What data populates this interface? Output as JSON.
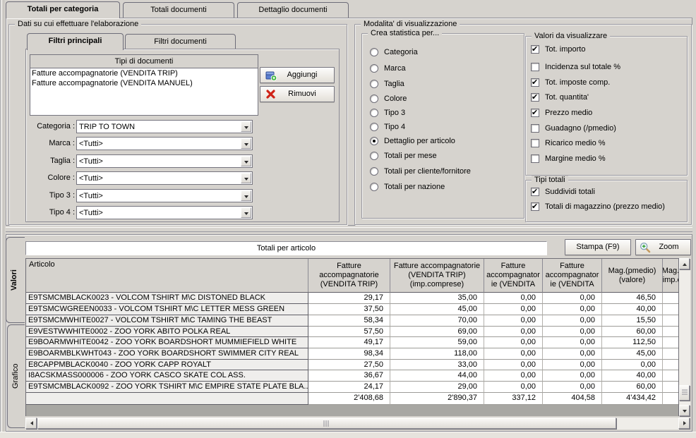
{
  "window": {
    "tabs": [
      {
        "label": "Totali per categoria",
        "selected": true
      },
      {
        "label": "Totali documenti",
        "selected": false
      },
      {
        "label": "Dettaglio documenti",
        "selected": false
      }
    ]
  },
  "filters_panel": {
    "group_title": "Dati su cui effettuare l'elaborazione",
    "tabs": [
      {
        "label": "Filtri principali",
        "selected": true
      },
      {
        "label": "Filtri documenti",
        "selected": false
      }
    ],
    "doc_types": {
      "header": "Tipi di documenti",
      "items": [
        "Fatture accompagnatorie (VENDITA TRIP)",
        "Fatture accompagnatorie (VENDITA MANUEL)"
      ]
    },
    "buttons": {
      "add": "Aggiungi",
      "remove": "Rimuovi"
    },
    "selectors": [
      {
        "label": "Categoria :",
        "value": "TRIP TO TOWN"
      },
      {
        "label": "Marca :",
        "value": "<Tutti>"
      },
      {
        "label": "Taglia :",
        "value": "<Tutti>"
      },
      {
        "label": "Colore :",
        "value": "<Tutti>"
      },
      {
        "label": "Tipo 3 :",
        "value": "<Tutti>"
      },
      {
        "label": "Tipo 4 :",
        "value": "<Tutti>"
      }
    ]
  },
  "display_panel": {
    "group_title": "Modalita' di visualizzazione",
    "statistic": {
      "group_title": "Crea statistica per...",
      "options": [
        {
          "label": "Categoria",
          "selected": false
        },
        {
          "label": "Marca",
          "selected": false
        },
        {
          "label": "Taglia",
          "selected": false
        },
        {
          "label": "Colore",
          "selected": false
        },
        {
          "label": "Tipo 3",
          "selected": false
        },
        {
          "label": "Tipo 4",
          "selected": false
        },
        {
          "label": "Dettaglio per articolo",
          "selected": true
        },
        {
          "label": "Totali per mese",
          "selected": false
        },
        {
          "label": "Totali per cliente/fornitore",
          "selected": false
        },
        {
          "label": "Totali per nazione",
          "selected": false
        }
      ]
    },
    "values": {
      "group_title": "Valori da visualizzare",
      "options": [
        {
          "label": "Tot. importo",
          "checked": true
        },
        {
          "label": "Incidenza sul totale %",
          "checked": false
        },
        {
          "label": "Tot. imposte comp.",
          "checked": true
        },
        {
          "label": "Tot. quantita'",
          "checked": true
        },
        {
          "label": "Prezzo medio",
          "checked": true
        },
        {
          "label": "Guadagno (/pmedio)",
          "checked": false
        },
        {
          "label": "Ricarico medio %",
          "checked": false
        },
        {
          "label": "Margine medio %",
          "checked": false
        }
      ]
    },
    "totals": {
      "group_title": "Tipi totali",
      "options": [
        {
          "label": "Suddividi totali",
          "checked": true
        },
        {
          "label": "Totali di magazzino (prezzo medio)",
          "checked": true
        }
      ]
    }
  },
  "results_panel": {
    "side_tabs": [
      {
        "label": "Valori",
        "selected": true
      },
      {
        "label": "Grafico",
        "selected": false
      }
    ],
    "title": "Totali per articolo",
    "buttons": {
      "print": "Stampa (F9)",
      "zoom": "Zoom"
    },
    "table": {
      "columns": [
        "Articolo",
        "Fatture\naccompagnatorie\n(VENDITA TRIP)",
        "Fatture accompagnatorie\n(VENDITA TRIP)\n(imp.comprese)",
        "Fatture\naccompagnator\nie (VENDITA",
        "Fatture\naccompagnator\nie (VENDITA",
        "Mag.(pmedio)\n(valore)",
        "Mag.\n(imp.c"
      ],
      "rows": [
        {
          "article": "E9TSMCMBLACK0023 - VOLCOM TSHIRT M\\C DISTONED BLACK",
          "v": [
            "29,17",
            "35,00",
            "0,00",
            "0,00",
            "46,50"
          ]
        },
        {
          "article": "E9TSMCWGREEN0033 - VOLCOM TSHIRT M\\C LETTER MESS GREEN",
          "v": [
            "37,50",
            "45,00",
            "0,00",
            "0,00",
            "40,00"
          ]
        },
        {
          "article": "E9TSMCMWHITE0027 - VOLCOM TSHIRT M\\C TAMING THE BEAST",
          "v": [
            "58,34",
            "70,00",
            "0,00",
            "0,00",
            "15,50"
          ]
        },
        {
          "article": "E9VESTWWHITE0002 - ZOO YORK ABITO POLKA REAL",
          "v": [
            "57,50",
            "69,00",
            "0,00",
            "0,00",
            "60,00"
          ]
        },
        {
          "article": "E9BOARMWHITE0042 - ZOO YORK BOARDSHORT MUMMIEFIELD WHITE",
          "v": [
            "49,17",
            "59,00",
            "0,00",
            "0,00",
            "112,50"
          ]
        },
        {
          "article": "E9BOARMBLKWHT043 - ZOO YORK BOARDSHORT SWIMMER CITY REAL",
          "v": [
            "98,34",
            "118,00",
            "0,00",
            "0,00",
            "45,00"
          ]
        },
        {
          "article": "E8CAPPMBLACK0040 - ZOO YORK CAPP ROYALT",
          "v": [
            "27,50",
            "33,00",
            "0,00",
            "0,00",
            "0,00"
          ]
        },
        {
          "article": "I8ACSKMASS000006 - ZOO YORK CASCO SKATE COL ASS.",
          "v": [
            "36,67",
            "44,00",
            "0,00",
            "0,00",
            "40,00"
          ]
        },
        {
          "article": "E9TSMCMBLACK0092 - ZOO YORK TSHIRT M\\C EMPIRE STATE PLATE BLA...",
          "v": [
            "24,17",
            "29,00",
            "0,00",
            "0,00",
            "60,00"
          ]
        }
      ],
      "totals": [
        "2'408,68",
        "2'890,37",
        "337,12",
        "404,58",
        "4'434,42"
      ]
    }
  }
}
